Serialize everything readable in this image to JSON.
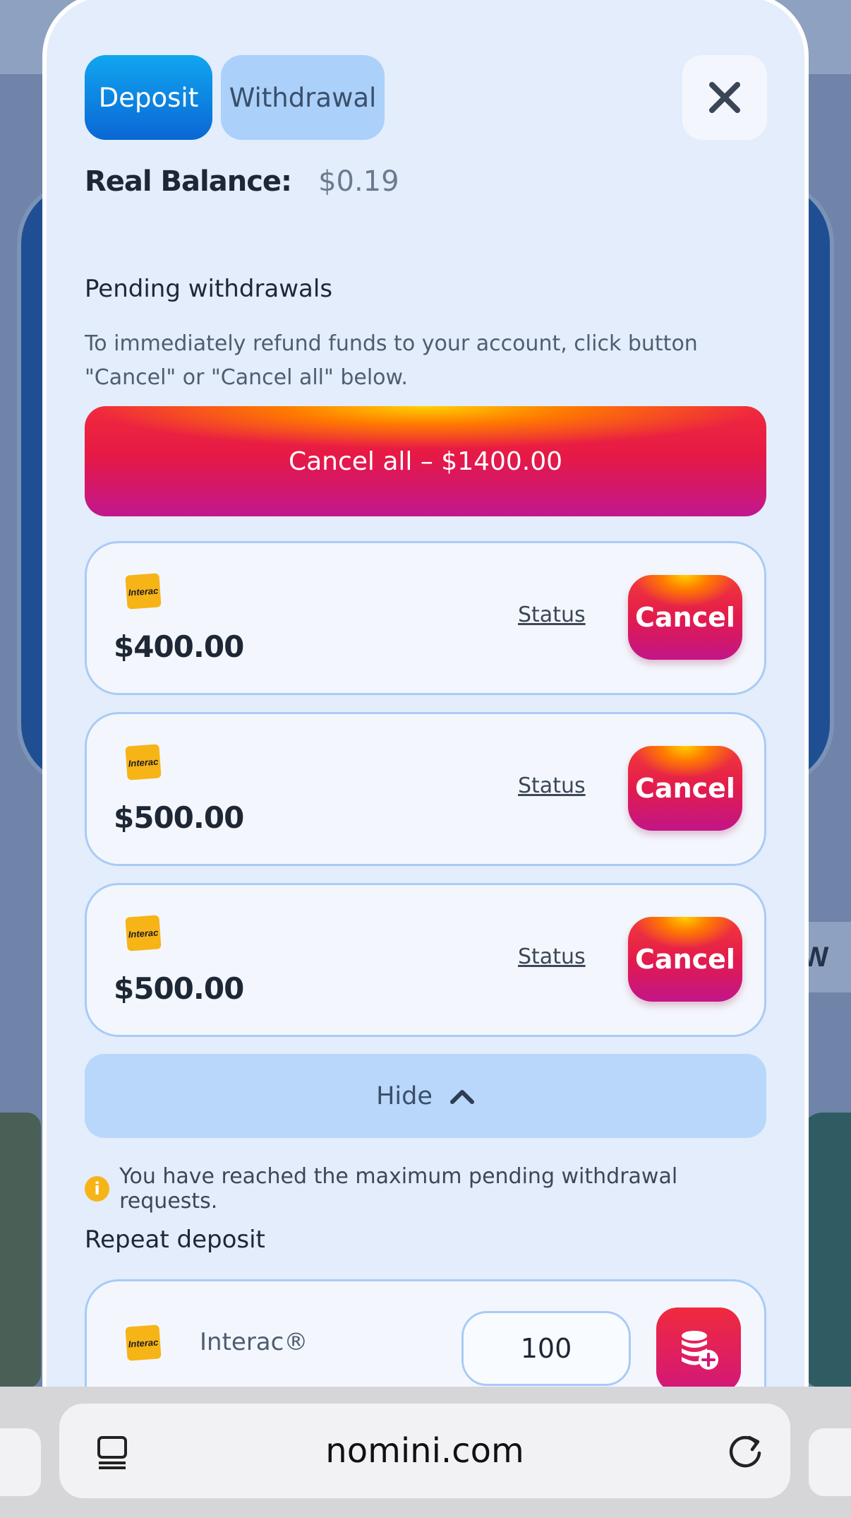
{
  "modal": {
    "tabs": {
      "deposit": "Deposit",
      "withdrawal": "Withdrawal"
    },
    "balance": {
      "label": "Real Balance:",
      "value": "$0.19"
    },
    "pending": {
      "title": "Pending withdrawals",
      "description": "To immediately refund funds to your account, click button \"Cancel\" or \"Cancel all\" below.",
      "cancel_all": "Cancel all – $1400.00",
      "items": [
        {
          "method_logo": "Interac",
          "amount": "$400.00",
          "status": "Status",
          "cancel": "Cancel"
        },
        {
          "method_logo": "Interac",
          "amount": "$500.00",
          "status": "Status",
          "cancel": "Cancel"
        },
        {
          "method_logo": "Interac",
          "amount": "$500.00",
          "status": "Status",
          "cancel": "Cancel"
        }
      ],
      "hide": "Hide"
    },
    "notice": "You have reached the maximum pending withdrawal requests.",
    "repeat": {
      "title": "Repeat deposit",
      "method_logo": "Interac",
      "method": "Interac®",
      "amount": "100"
    }
  },
  "background": {
    "partial_text": "EW"
  },
  "browser": {
    "url": "nomini.com"
  },
  "colors": {
    "accent_blue": "#0a67d4",
    "cancel_red": "#e31b4c",
    "modal_bg": "#e3edfb"
  }
}
